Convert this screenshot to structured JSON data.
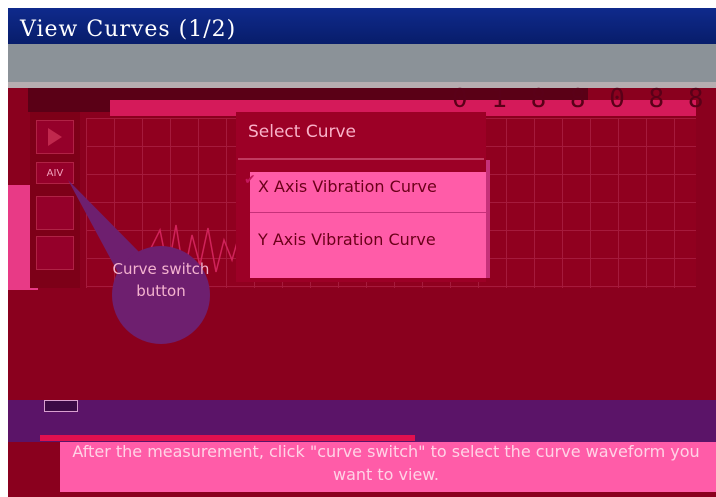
{
  "window": {
    "title": "View Curves (1/2)"
  },
  "toolbar": {
    "curve_switch_label": "AIV"
  },
  "dialog": {
    "title": "Select Curve",
    "options": [
      {
        "label": "X Axis Vibration Curve",
        "selected": true
      },
      {
        "label": "Y Axis Vibration Curve",
        "selected": false
      }
    ]
  },
  "callout": {
    "text": "Curve switch button"
  },
  "instruction": {
    "text": "After the measurement, click \"curve switch\" to select the curve waveform you want to view."
  },
  "colors": {
    "title_bar": "#0f2a8c",
    "frame": "#8a001e",
    "dialog": "#9c0026",
    "list": "#ff5ca8",
    "callout": "#6e1f6f",
    "bottom_bar": "#5b1468"
  }
}
